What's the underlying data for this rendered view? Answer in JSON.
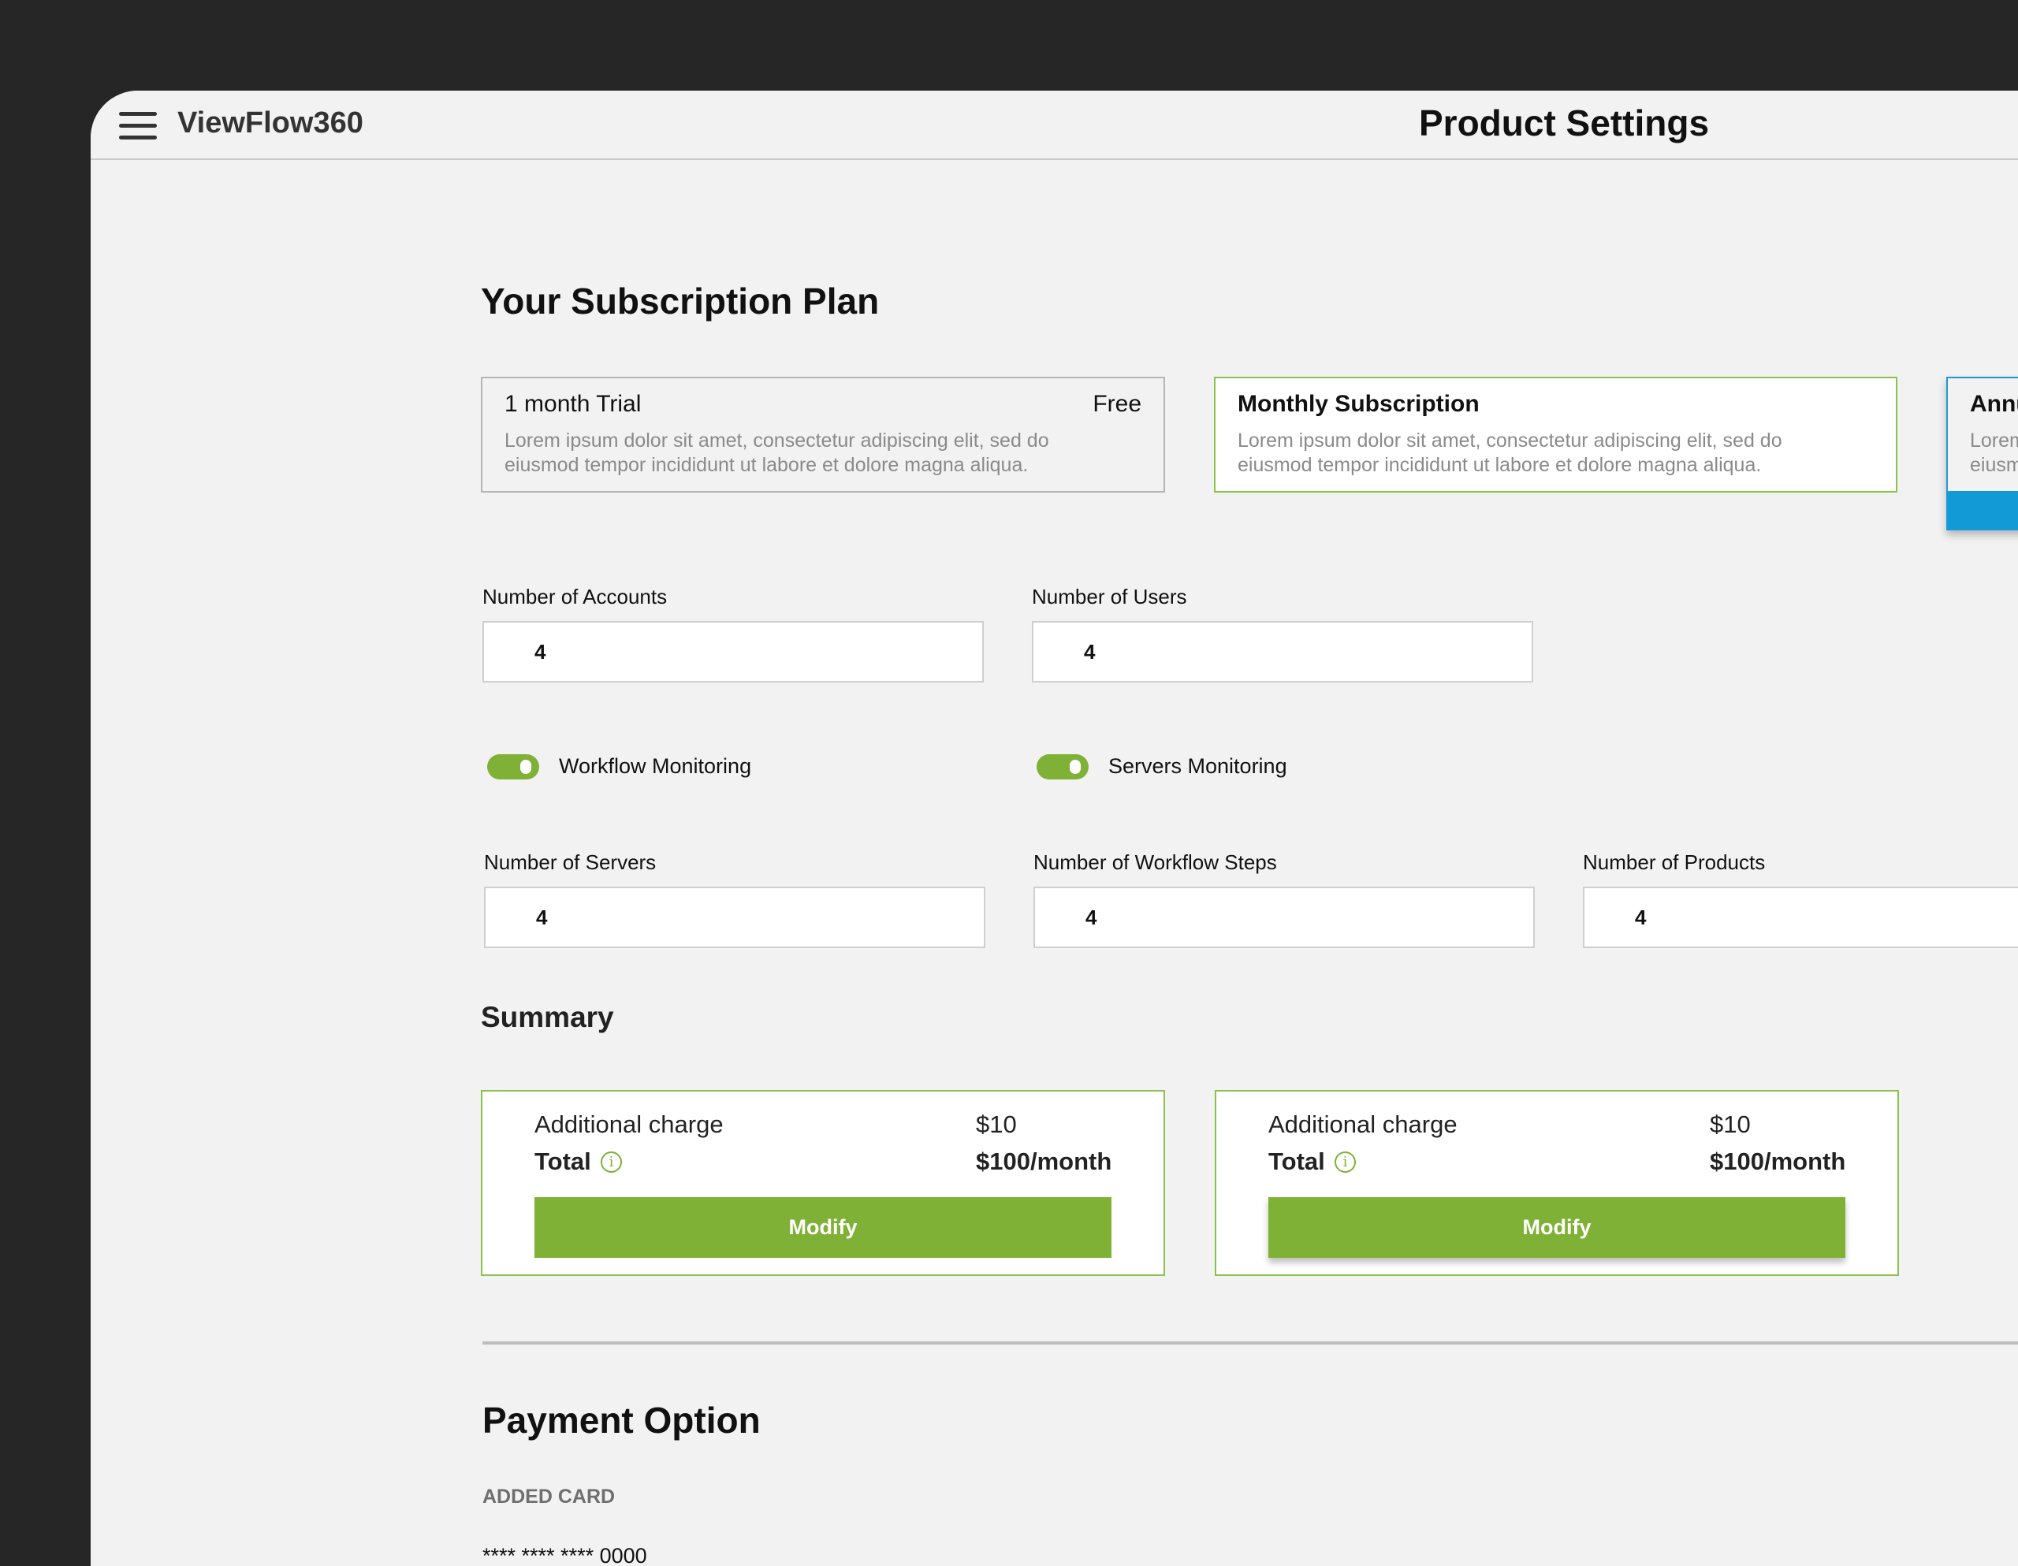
{
  "header": {
    "menu_icon": "hamburger-menu-icon",
    "brand": "ViewFlow360",
    "title": "Product Settings"
  },
  "subscription": {
    "heading": "Your Subscription Plan",
    "plans": [
      {
        "name": "1 month Trial",
        "price": "Free",
        "description_line1": "Lorem ipsum dolor sit amet, consectetur adipiscing elit, sed do",
        "description_line2": "eiusmod tempor incididunt ut labore et dolore magna aliqua.",
        "selected": false
      },
      {
        "name": "Monthly Subscription",
        "price": "",
        "description_line1": "Lorem ipsum dolor sit amet, consectetur adipiscing elit, sed do",
        "description_line2": "eiusmod tempor incididunt ut labore et dolore magna aliqua.",
        "selected": true
      },
      {
        "name": "Annu",
        "price": "",
        "description_line1": "Lorem",
        "description_line2": "eiusm",
        "selected": false
      }
    ]
  },
  "fields": {
    "accounts": {
      "label": "Number of Accounts",
      "value": "4"
    },
    "users": {
      "label": "Number of Users",
      "value": "4"
    },
    "servers": {
      "label": "Number of Servers",
      "value": "4"
    },
    "workflow_steps": {
      "label": "Number of Workflow Steps",
      "value": "4"
    },
    "products": {
      "label": "Number of Products",
      "value": "4"
    }
  },
  "toggles": {
    "workflow": {
      "label": "Workflow Monitoring",
      "on": true
    },
    "servers": {
      "label": "Servers Monitoring",
      "on": true
    }
  },
  "summary": {
    "heading": "Summary",
    "cards": [
      {
        "additional_label": "Additional charge",
        "additional_value": "$10",
        "total_label": "Total",
        "total_value": "$100/month",
        "button": "Modify"
      },
      {
        "additional_label": "Additional charge",
        "additional_value": "$10",
        "total_label": "Total",
        "total_value": "$100/month",
        "button": "Modify"
      }
    ]
  },
  "payment": {
    "heading": "Payment Option",
    "added_card_label": "ADDED CARD",
    "card_number": "**** **** **** 0000"
  },
  "colors": {
    "accent_green": "#7fb136",
    "accent_blue": "#119ad6",
    "frame_dark": "#262626",
    "background": "#f2f2f2"
  }
}
